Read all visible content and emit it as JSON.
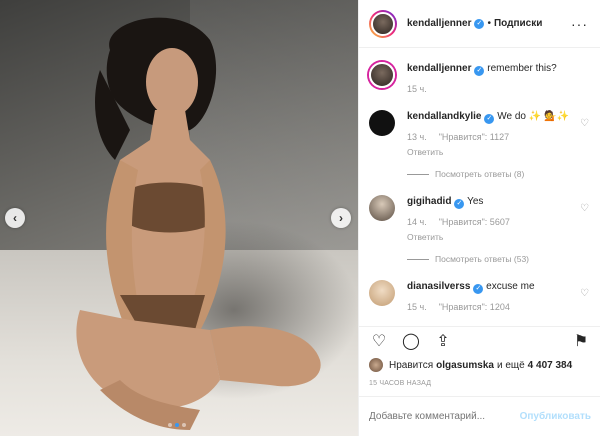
{
  "post": {
    "author": "kendalljenner",
    "separator": "•",
    "follow_label": "Подписки",
    "more_label": "···"
  },
  "carousel": {
    "prev_label": "‹",
    "next_label": "›",
    "current_slide": 2,
    "total_slides": 3
  },
  "comments": [
    {
      "user": "kendalljenner",
      "verified": true,
      "text": "remember this?",
      "time": "15 ч.",
      "likes": "",
      "reply": "",
      "thread": ""
    },
    {
      "user": "kendallandkylie",
      "verified": true,
      "text": "We do ✨ 💁✨",
      "time": "13 ч.",
      "likes": "\"Нравится\": 1127",
      "reply": "Ответить",
      "thread": "Посмотреть ответы (8)"
    },
    {
      "user": "gigihadid",
      "verified": true,
      "text": "Yes",
      "time": "14 ч.",
      "likes": "\"Нравится\": 5607",
      "reply": "Ответить",
      "thread": "Посмотреть ответы (53)"
    },
    {
      "user": "dianasilverss",
      "verified": true,
      "text": "excuse me",
      "time": "15 ч.",
      "likes": "\"Нравится\": 1204",
      "reply": "",
      "thread": ""
    }
  ],
  "actions": {
    "heart": "♡",
    "comment": "◯",
    "share": "⇪",
    "save": "⚑"
  },
  "likes": {
    "prefix": "Нравится",
    "user": "olgasumska",
    "middle": "и ещё",
    "count": "4 407 384"
  },
  "timestamp": "15 ЧАСОВ НАЗАД",
  "add_comment": {
    "placeholder": "Добавьте комментарий...",
    "publish_label": "Опубликовать"
  }
}
